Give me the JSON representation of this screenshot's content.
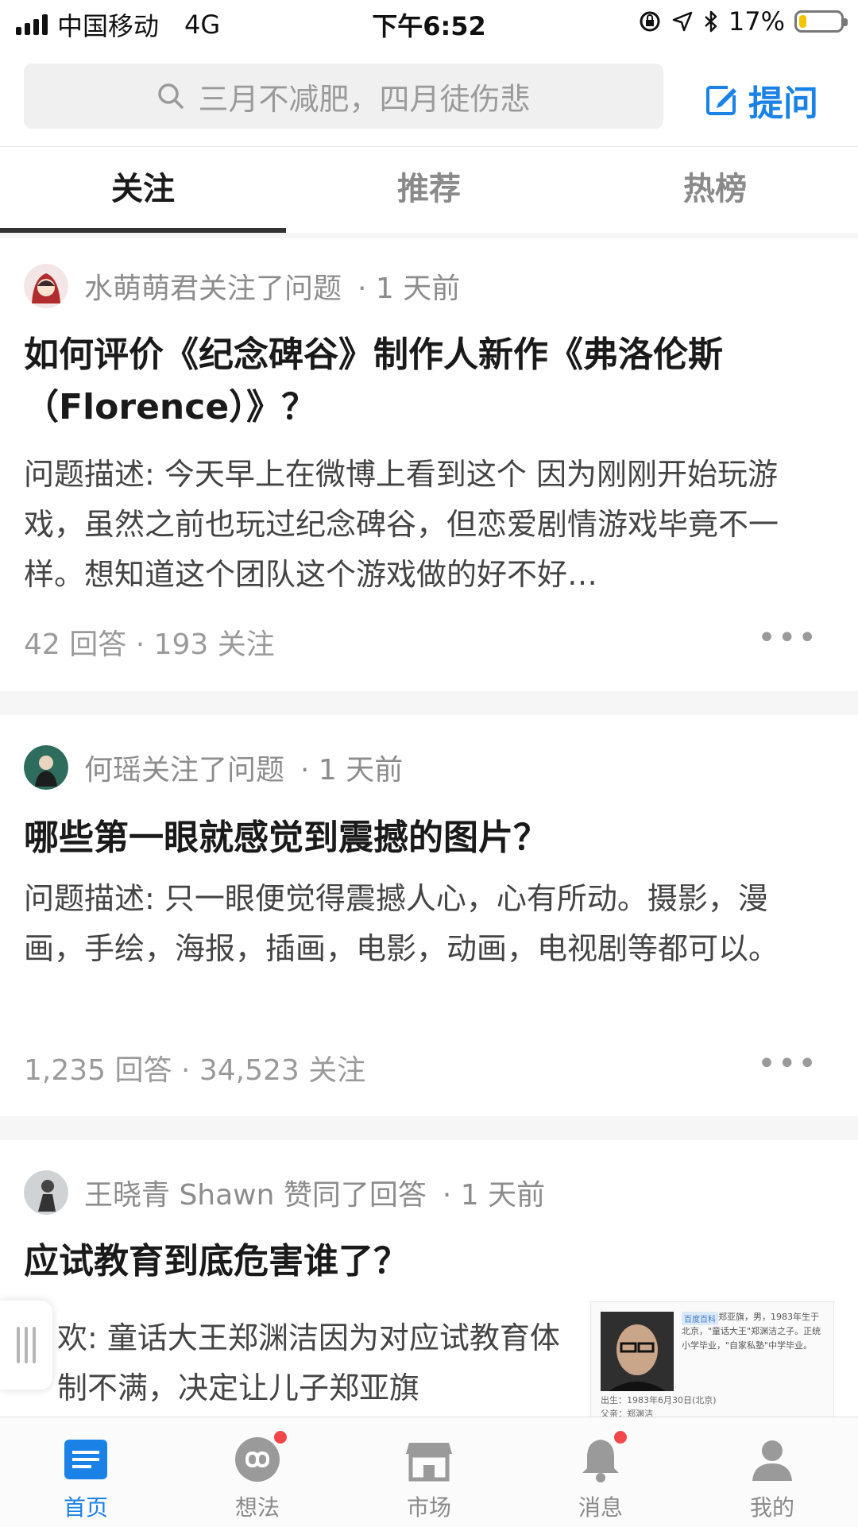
{
  "status_bar": {
    "carrier": "中国移动",
    "network": "4G",
    "time": "下午6:52",
    "battery_percent_text": "17%",
    "battery_level": 0.17
  },
  "search": {
    "placeholder": "三月不减肥，四月徒伤悲",
    "ask_label": "提问"
  },
  "tabs": [
    {
      "label": "关注",
      "active": true
    },
    {
      "label": "推荐",
      "active": false
    },
    {
      "label": "热榜",
      "active": false
    }
  ],
  "feed": [
    {
      "actor": "水萌萌君关注了问题",
      "time": "· 1 天前",
      "title": "如何评价《纪念碑谷》制作人新作《弗洛伦斯（Florence）》？",
      "description": "问题描述: 今天早上在微博上看到这个 因为刚刚开始玩游戏，虽然之前也玩过纪念碑谷，但恋爱剧情游戏毕竟不一样。想知道这个团队这个游戏做的好不好…",
      "stats": "42 回答 · 193 关注",
      "more": "•••"
    },
    {
      "actor": "何瑶关注了问题",
      "time": "· 1 天前",
      "title": "哪些第一眼就感觉到震撼的图片？",
      "description": "问题描述: 只一眼便觉得震撼人心，心有所动。摄影，漫画，手绘，海报，插画，电影，动画，电视剧等都可以。",
      "stats": "1,235 回答 · 34,523 关注",
      "more": "•••"
    },
    {
      "actor": "王晓青 Shawn 赞同了回答",
      "time": "· 1 天前",
      "title": "应试教育到底危害谁了？",
      "description": "欢: 童话大王郑渊洁因为对应试教育体制不满，决定让儿子郑亚旗",
      "thumbnail": {
        "tag": "百度百科",
        "text": "郑亚旗，男，1983年生于北京，\"童话大王\"郑渊洁之子。正统小学毕业，\"自家私塾\"中学毕业。",
        "birth": "出生：1983年6月30日(北京)",
        "father": "父亲：郑渊洁"
      }
    }
  ],
  "bottom_nav": [
    {
      "label": "首页",
      "icon": "home-icon",
      "active": true,
      "badge": false
    },
    {
      "label": "想法",
      "icon": "ideas-icon",
      "active": false,
      "badge": true
    },
    {
      "label": "市场",
      "icon": "market-icon",
      "active": false,
      "badge": false
    },
    {
      "label": "消息",
      "icon": "bell-icon",
      "active": false,
      "badge": true
    },
    {
      "label": "我的",
      "icon": "profile-icon",
      "active": false,
      "badge": false
    }
  ],
  "colors": {
    "accent": "#1a82e6",
    "badge": "#f2484b",
    "battery": "#f5c400"
  }
}
